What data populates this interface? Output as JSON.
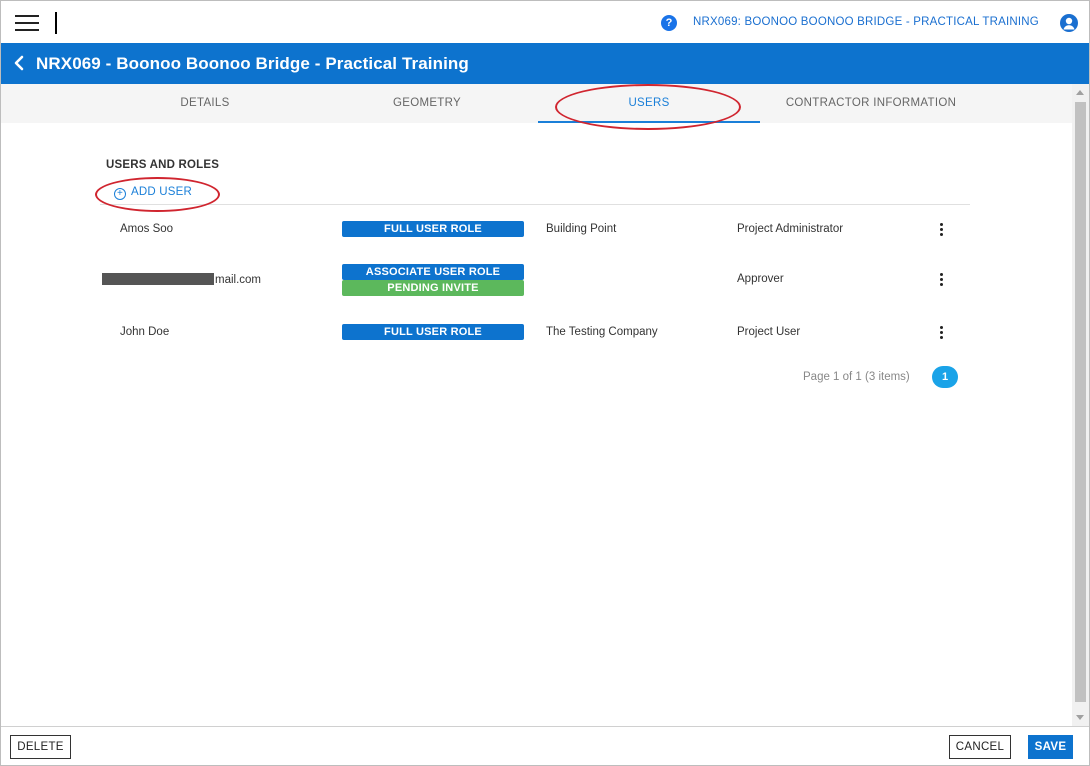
{
  "topbar": {
    "project_link": "NRX069: BOONOO BOONOO BRIDGE - PRACTICAL TRAINING",
    "help_glyph": "?"
  },
  "header": {
    "title": "NRX069 - Boonoo Boonoo Bridge - Practical Training"
  },
  "tabs": [
    {
      "label": "DETAILS",
      "active": false
    },
    {
      "label": "GEOMETRY",
      "active": false
    },
    {
      "label": "USERS",
      "active": true
    },
    {
      "label": "CONTRACTOR INFORMATION",
      "active": false
    }
  ],
  "users_section": {
    "title": "USERS AND ROLES",
    "add_user_label": "ADD USER",
    "rows": [
      {
        "name": "Amos Soo",
        "badges": [
          "FULL USER ROLE"
        ],
        "company": "Building Point",
        "role": "Project Administrator"
      },
      {
        "name": "mail.com",
        "name_redacted": true,
        "badges": [
          "ASSOCIATE USER ROLE",
          "PENDING INVITE"
        ],
        "company": "",
        "role": "Approver"
      },
      {
        "name": "John Doe",
        "badges": [
          "FULL USER ROLE"
        ],
        "company": "The Testing Company",
        "role": "Project User"
      }
    ]
  },
  "pagination": {
    "summary": "Page 1 of 1 (3 items)",
    "current_page": "1"
  },
  "footer": {
    "delete_label": "DELETE",
    "cancel_label": "CANCEL",
    "save_label": "SAVE"
  },
  "colors": {
    "primary": "#0d73ce",
    "pending": "#5cb85c",
    "annotation": "#d0252f",
    "page_button": "#1aa3e8"
  },
  "icons": {
    "menu": "hamburger-icon",
    "help": "help-icon",
    "account": "user-account-icon",
    "back": "chevron-left-icon",
    "add": "plus-circle-icon",
    "row_menu": "kebab-menu-icon"
  }
}
